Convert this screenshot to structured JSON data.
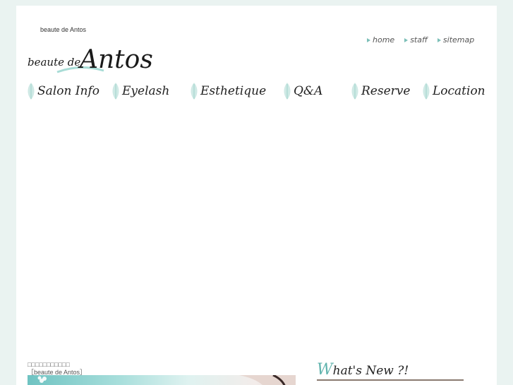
{
  "site": {
    "tagline": "beaute de Antos",
    "logo_small": "beaute de",
    "logo_big": "Antos"
  },
  "util_nav": [
    {
      "label": "home",
      "icon": "arrow-right-icon"
    },
    {
      "label": "staff",
      "icon": "arrow-right-icon"
    },
    {
      "label": "sitemap",
      "icon": "arrow-right-icon"
    }
  ],
  "main_nav": [
    {
      "label": "Salon Info",
      "icon": "leaf-icon"
    },
    {
      "label": "Eyelash",
      "icon": "leaf-icon"
    },
    {
      "label": "Esthetique",
      "icon": "leaf-icon"
    },
    {
      "label": "Q&A",
      "icon": "leaf-icon"
    },
    {
      "label": "Reserve",
      "icon": "leaf-icon"
    },
    {
      "label": "Location",
      "icon": "leaf-icon"
    }
  ],
  "content": {
    "subtitle_boxes": "□□□□□□□□□□□",
    "subtitle_name": "［beaute de Antos］"
  },
  "whats_new": {
    "first_letter": "W",
    "rest": "hat's New ?!"
  },
  "colors": {
    "background": "#eaf3f1",
    "accent": "#7cbfb8",
    "page": "#ffffff"
  }
}
